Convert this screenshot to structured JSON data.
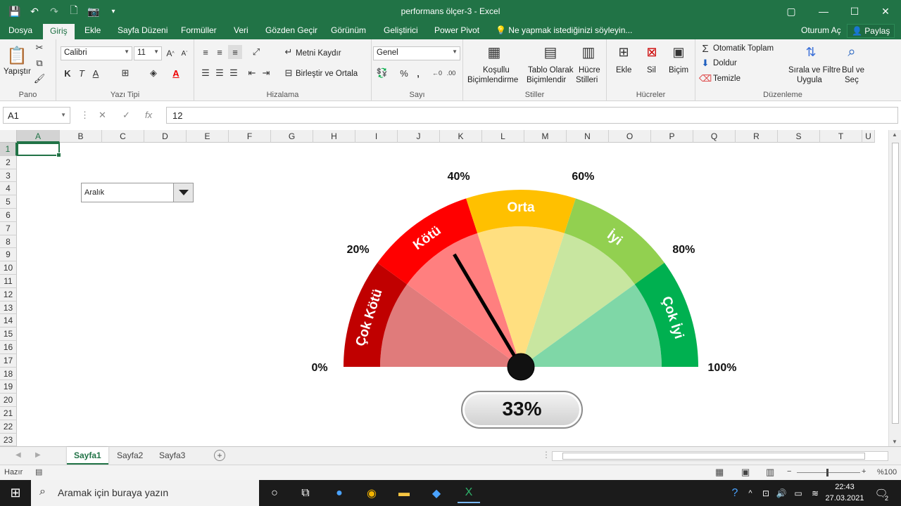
{
  "window": {
    "title": "performans ölçer-3 - Excel",
    "controls": [
      "▢",
      "—",
      "☐",
      "✕"
    ]
  },
  "qat": {
    "save": "💾",
    "undo": "↶",
    "redo": "↷",
    "new": "🗋",
    "camera": "📷",
    "more": "▾"
  },
  "tabs": [
    {
      "label": "Dosya"
    },
    {
      "label": "Giriş"
    },
    {
      "label": "Ekle"
    },
    {
      "label": "Sayfa Düzeni"
    },
    {
      "label": "Formüller"
    },
    {
      "label": "Veri"
    },
    {
      "label": "Gözden Geçir"
    },
    {
      "label": "Görünüm"
    },
    {
      "label": "Geliştirici"
    },
    {
      "label": "Power Pivot"
    }
  ],
  "tellme": "Ne yapmak istediğinizi söyleyin...",
  "signin": "Oturum Aç",
  "share": "Paylaş",
  "ribbon": {
    "clipboard": {
      "paste": "Yapıştır",
      "label": "Pano"
    },
    "font": {
      "name": "Calibri",
      "size": "11",
      "bold": "K",
      "italic": "T",
      "underline": "A",
      "label": "Yazı Tipi"
    },
    "alignment": {
      "wrap": "Metni Kaydır",
      "merge": "Birleştir ve Ortala",
      "label": "Hizalama"
    },
    "number": {
      "format": "Genel",
      "percent": "%",
      "comma": "،",
      "label": "Sayı"
    },
    "styles": {
      "conditional": [
        "Koşullu",
        "Biçimlendirme"
      ],
      "table": [
        "Tablo Olarak",
        "Biçimlendir"
      ],
      "cell": [
        "Hücre",
        "Stilleri"
      ],
      "label": "Stiller"
    },
    "cells": {
      "insert": "Ekle",
      "delete": "Sil",
      "format": "Biçim",
      "label": "Hücreler"
    },
    "editing": {
      "autosum": "Otomatik Toplam",
      "fill": "Doldur",
      "clear": "Temizle",
      "sort": [
        "Sırala ve Filtre",
        "Uygula"
      ],
      "find": [
        "Bul ve",
        "Seç"
      ],
      "label": "Düzenleme"
    }
  },
  "formula_bar": {
    "name_box": "A1",
    "cancel": "✕",
    "enter": "✓",
    "fx": "fx",
    "content": "12"
  },
  "columns": [
    "A",
    "B",
    "C",
    "D",
    "E",
    "F",
    "G",
    "H",
    "I",
    "J",
    "K",
    "L",
    "M",
    "N",
    "O",
    "P",
    "Q",
    "R",
    "S",
    "T",
    "U"
  ],
  "rows": [
    "1",
    "2",
    "3",
    "4",
    "5",
    "6",
    "7",
    "8",
    "9",
    "10",
    "11",
    "12",
    "13",
    "14",
    "15",
    "16",
    "17",
    "18",
    "19",
    "20",
    "21",
    "22",
    "23"
  ],
  "dropdown": {
    "value": "Aralık"
  },
  "gauge": {
    "value_percent": 33,
    "value_label": "33%",
    "tick_labels": [
      "0%",
      "20%",
      "40%",
      "60%",
      "80%",
      "100%"
    ],
    "segments": [
      {
        "label": "Çok Kötü",
        "outer": "#c00000",
        "inner": "#e07b7b"
      },
      {
        "label": "Kötü",
        "outer": "#ff0000",
        "inner": "#ff7f7f"
      },
      {
        "label": "Orta",
        "outer": "#ffc000",
        "inner": "#ffdf80"
      },
      {
        "label": "İyi",
        "outer": "#92d050",
        "inner": "#c8e6a0"
      },
      {
        "label": "Çok İyi",
        "outer": "#00b050",
        "inner": "#7fd7a7"
      }
    ]
  },
  "sheets": [
    {
      "label": "Sayfa1"
    },
    {
      "label": "Sayfa2"
    },
    {
      "label": "Sayfa3"
    }
  ],
  "status": {
    "ready": "Hazır",
    "zoom": "%100"
  },
  "taskbar": {
    "search_placeholder": "Aramak için buraya yazın",
    "time": "22:43",
    "date": "27.03.2021",
    "notifications": "2"
  }
}
